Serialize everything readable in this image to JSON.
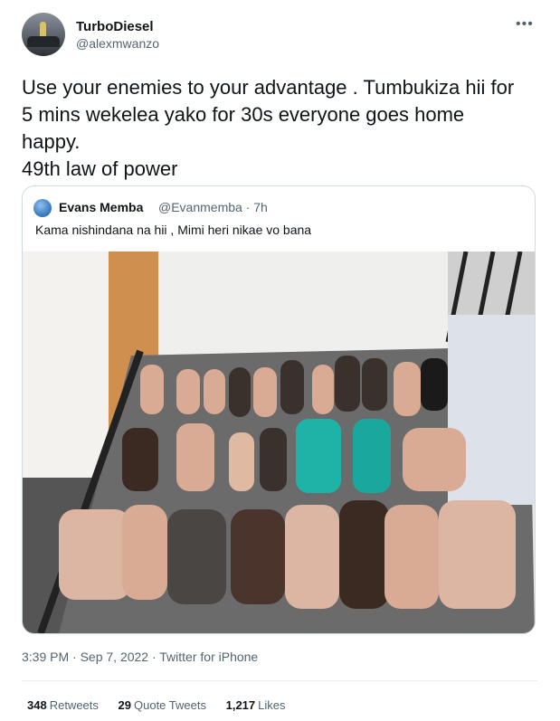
{
  "author": {
    "name": "TurboDiesel",
    "handle": "@alexmwanzo"
  },
  "tweet_text": "Use your enemies to your advantage . Tumbukiza hii for\n5 mins wekelea yako for 30s everyone goes home\nhappy.\n49th law of power",
  "quoted": {
    "name": "Evans Memba",
    "handle_time": "@Evanmemba · 7h",
    "text": "Kama nishindana na hii , Mimi heri nikae vo bana"
  },
  "timestamp": "3:39 PM · Sep 7, 2022 · Twitter for iPhone",
  "stats": [
    {
      "count": "348",
      "label": "Retweets"
    },
    {
      "count": "29",
      "label": "Quote Tweets"
    },
    {
      "count": "1,217",
      "label": "Likes"
    }
  ],
  "colors": {
    "text": "#0f1419",
    "secondary": "#536471",
    "border": "#cfd9de"
  },
  "icons": [
    "more-icon"
  ]
}
